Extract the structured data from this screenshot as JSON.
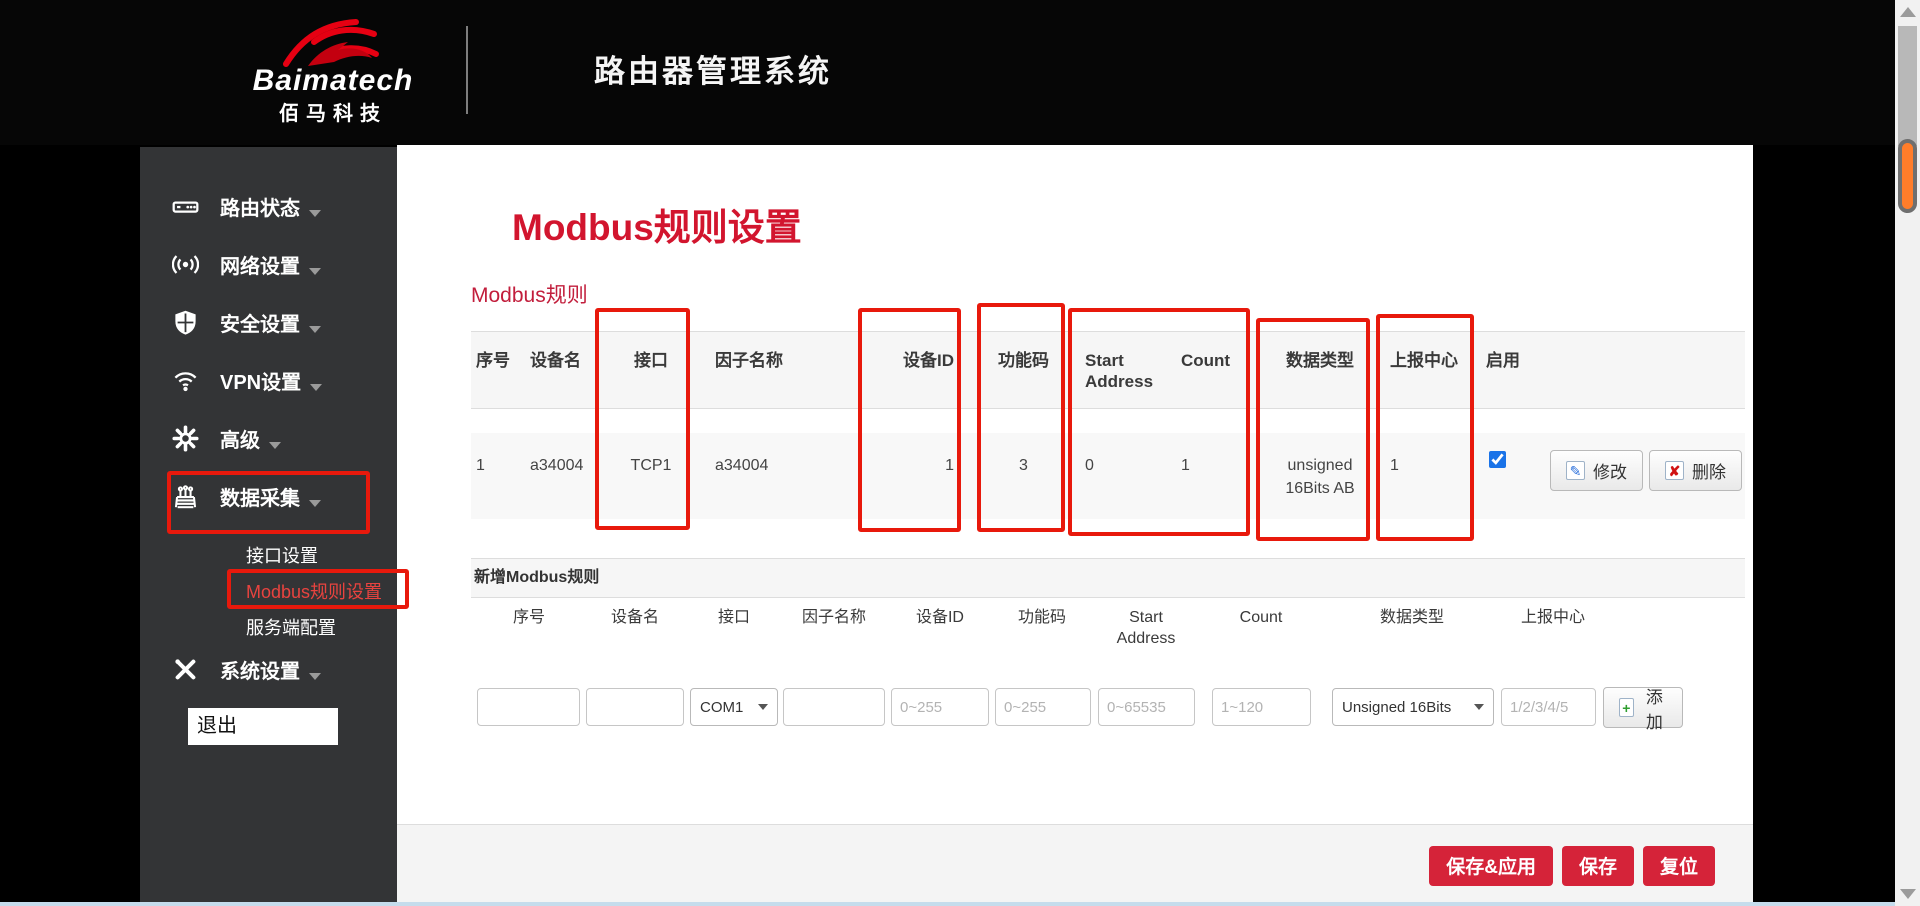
{
  "colors": {
    "brand_red": "#e60012",
    "title_red": "#d2152e",
    "button_red": "#d52339",
    "annotation_red": "#e8190c",
    "checkbox_blue": "#1a73e8",
    "scroll_marker_orange": "#ff7d2a",
    "sidebar_bg": "#333436"
  },
  "header": {
    "brand": "Baimatech",
    "brand_cn": "佰马科技",
    "app_title": "路由器管理系统"
  },
  "sidebar": {
    "items": [
      {
        "label": "路由状态",
        "icon": "router-icon"
      },
      {
        "label": "网络设置",
        "icon": "network-icon"
      },
      {
        "label": "安全设置",
        "icon": "shield-icon"
      },
      {
        "label": "VPN设置",
        "icon": "vpn-icon"
      },
      {
        "label": "高级",
        "icon": "gear-icon"
      },
      {
        "label": "数据采集",
        "icon": "data-collect-icon"
      }
    ],
    "submenu": [
      {
        "label": "接口设置",
        "active": false
      },
      {
        "label": "Modbus规则设置",
        "active": true
      },
      {
        "label": "服务端配置",
        "active": false
      }
    ],
    "system_item": {
      "label": "系统设置",
      "icon": "tools-icon"
    },
    "logout_label": "退出"
  },
  "main": {
    "page_title": "Modbus规则设置",
    "section_title": "Modbus规则",
    "table": {
      "headers": [
        "序号",
        "设备名",
        "接口",
        "因子名称",
        "设备ID",
        "功能码",
        "Start Address",
        "Count",
        "数据类型",
        "上报中心",
        "启用"
      ],
      "row": [
        "1",
        "a34004",
        "TCP1",
        "a34004",
        "1",
        "3",
        "0",
        "1",
        "unsigned 16Bits AB",
        "1"
      ],
      "row_enabled": true,
      "modify_label": "修改",
      "delete_label": "删除"
    },
    "add_section": {
      "title": "新增Modbus规则",
      "labels": [
        "序号",
        "设备名",
        "接口",
        "因子名称",
        "设备ID",
        "功能码",
        "Start Address",
        "Count",
        "数据类型",
        "上报中心"
      ],
      "interface_value": "COM1",
      "datatype_value": "Unsigned 16Bits",
      "placeholders": {
        "device_id": "0~255",
        "func_code": "0~255",
        "start_address": "0~65535",
        "count": "1~120",
        "report_center": "1/2/3/4/5"
      },
      "add_label": "添加"
    },
    "footer_buttons": [
      "保存&应用",
      "保存",
      "复位"
    ]
  }
}
